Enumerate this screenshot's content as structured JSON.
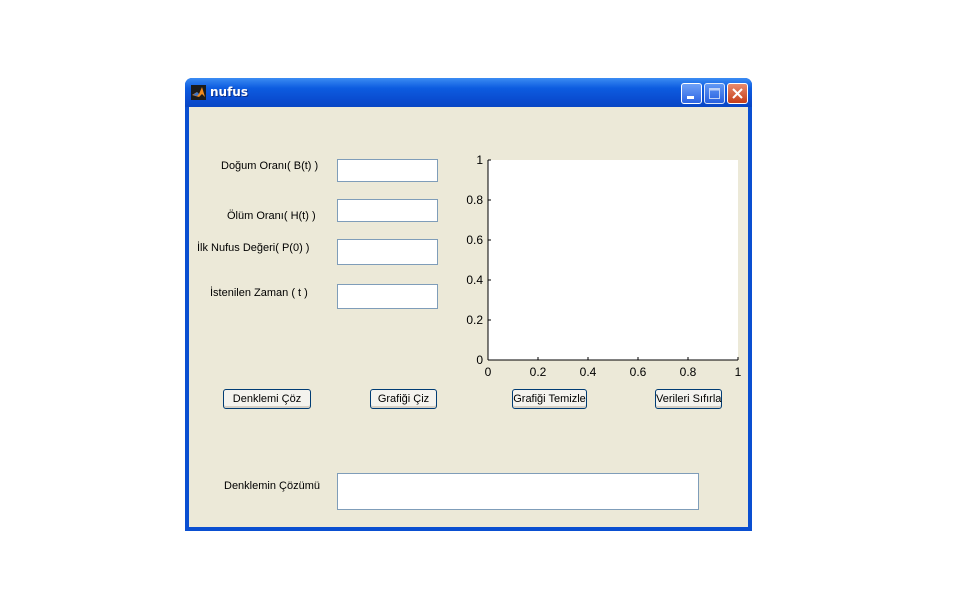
{
  "window": {
    "title": "nufus",
    "controls": {
      "minimize": "minimize",
      "maximize": "maximize",
      "close": "close"
    }
  },
  "form": {
    "birth_rate_label": "Doğum Oranı( B(t) )",
    "death_rate_label": "Ölüm Oranı( H(t) )",
    "initial_pop_label": "İlk Nufus Değeri( P(0) )",
    "time_label": "İstenilen Zaman ( t )",
    "birth_rate_value": "",
    "death_rate_value": "",
    "initial_pop_value": "",
    "time_value": "",
    "solution_label": "Denklemin Çözümü",
    "solution_value": ""
  },
  "buttons": {
    "solve": "Denklemi  Çöz",
    "plot": "Grafiği Çiz",
    "clear_plot": "Grafiği Temizle",
    "reset": "Verileri Sıfırla"
  },
  "chart_data": {
    "type": "line",
    "series": [],
    "xlim": [
      0,
      1
    ],
    "ylim": [
      0,
      1
    ],
    "xticks": [
      "0",
      "0.2",
      "0.4",
      "0.6",
      "0.8",
      "1"
    ],
    "yticks": [
      "0",
      "0.2",
      "0.4",
      "0.6",
      "0.8",
      "1"
    ],
    "grid": false
  },
  "colors": {
    "titlebar": "#0a4fd1",
    "client_bg": "#ece9d8",
    "close_button": "#c63d19"
  }
}
